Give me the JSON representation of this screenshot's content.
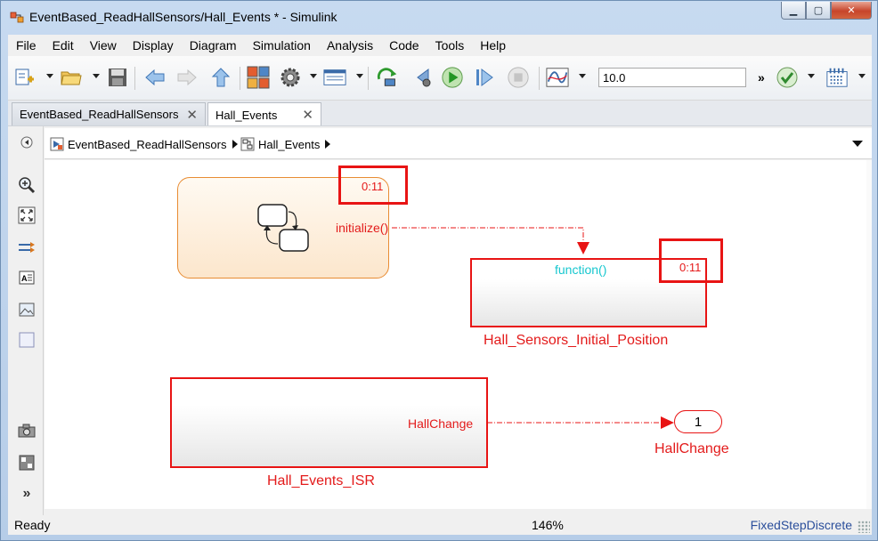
{
  "window": {
    "title": "EventBased_ReadHallSensors/Hall_Events * - Simulink",
    "controls": {
      "minimize": "▁",
      "maximize": "▢",
      "close": "✕"
    }
  },
  "menu": [
    "File",
    "Edit",
    "View",
    "Display",
    "Diagram",
    "Simulation",
    "Analysis",
    "Code",
    "Tools",
    "Help"
  ],
  "toolbar": {
    "stop_time": "10.0",
    "more": "»"
  },
  "tabs": [
    {
      "label": "EventBased_ReadHallSensors",
      "close": "✕"
    },
    {
      "label": "Hall_Events",
      "close": "✕"
    }
  ],
  "breadcrumb": [
    {
      "label": "EventBased_ReadHallSensors"
    },
    {
      "label": "Hall_Events"
    }
  ],
  "diagram": {
    "chart": {
      "sample_time": "0:11",
      "event_port": "initialize()"
    },
    "function_block": {
      "trigger_label": "function()",
      "sample_time": "0:11",
      "name": "Hall_Sensors_Initial_Position"
    },
    "isr_block": {
      "port_label": "HallChange",
      "name": "Hall_Events_ISR"
    },
    "outport": {
      "number": "1",
      "name": "HallChange"
    }
  },
  "status": {
    "left": "Ready",
    "zoom": "146%",
    "solver": "FixedStepDiscrete"
  },
  "colors": {
    "highlight_red": "#e81414",
    "chart_orange": "#e88c33",
    "function_cyan": "#17c7cf"
  }
}
